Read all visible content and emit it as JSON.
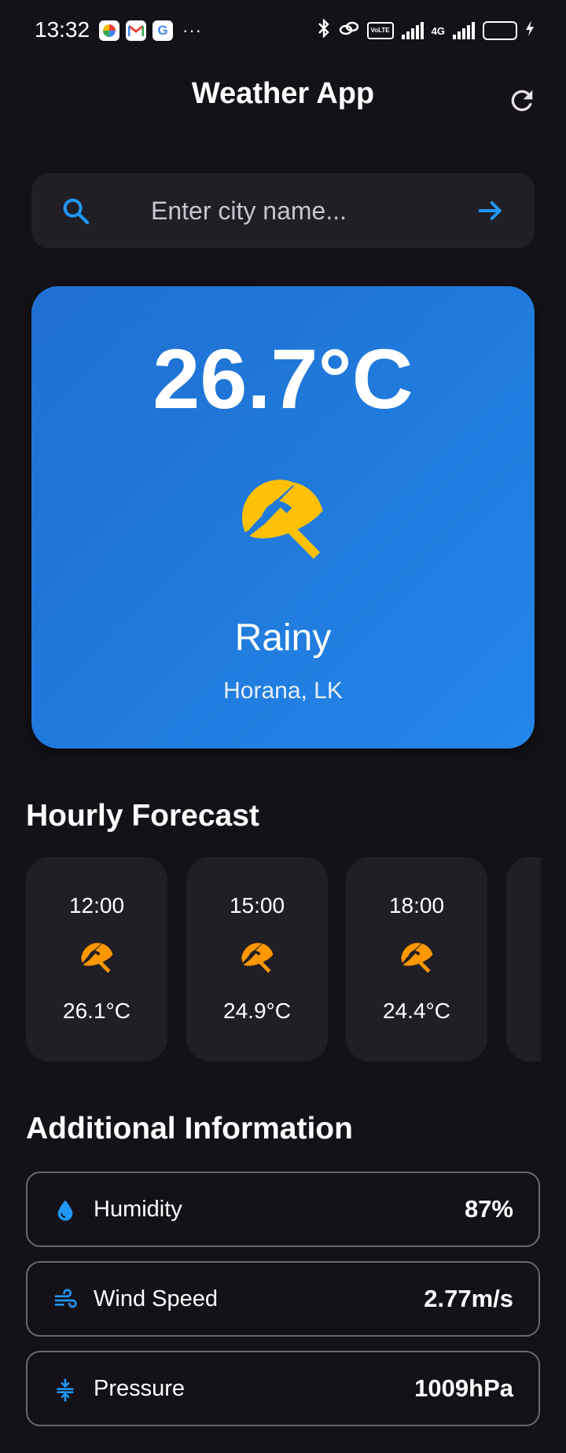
{
  "status_bar": {
    "time": "13:32",
    "apps": [
      "photos-icon",
      "gmail-icon",
      "google-icon"
    ],
    "more": "···",
    "network_tag": "VoLTE",
    "network_4g": "4G",
    "battery_level": "68"
  },
  "header": {
    "title": "Weather App",
    "refresh_icon": "refresh-icon"
  },
  "search": {
    "placeholder": "Enter city name...",
    "value": ""
  },
  "current": {
    "temperature": "26.7°C",
    "condition": "Rainy",
    "location": "Horana, LK",
    "icon": "umbrella-icon"
  },
  "hourly": {
    "title": "Hourly Forecast",
    "items": [
      {
        "time": "12:00",
        "temp": "26.1°C",
        "icon": "umbrella-icon"
      },
      {
        "time": "15:00",
        "temp": "24.9°C",
        "icon": "umbrella-icon"
      },
      {
        "time": "18:00",
        "temp": "24.4°C",
        "icon": "umbrella-icon"
      }
    ]
  },
  "additional": {
    "title": "Additional Information",
    "items": [
      {
        "label": "Humidity",
        "value": "87%",
        "icon": "water-drop-icon"
      },
      {
        "label": "Wind Speed",
        "value": "2.77m/s",
        "icon": "wind-icon"
      },
      {
        "label": "Pressure",
        "value": "1009hPa",
        "icon": "pressure-icon"
      }
    ]
  },
  "colors": {
    "background": "#141218",
    "surface": "#211f26",
    "card_gradient_start": "#1f6fd0",
    "card_gradient_end": "#2286e8",
    "accent": "#2196f3",
    "umbrella_main": "#ffc107",
    "umbrella_hourly": "#ff9800"
  }
}
